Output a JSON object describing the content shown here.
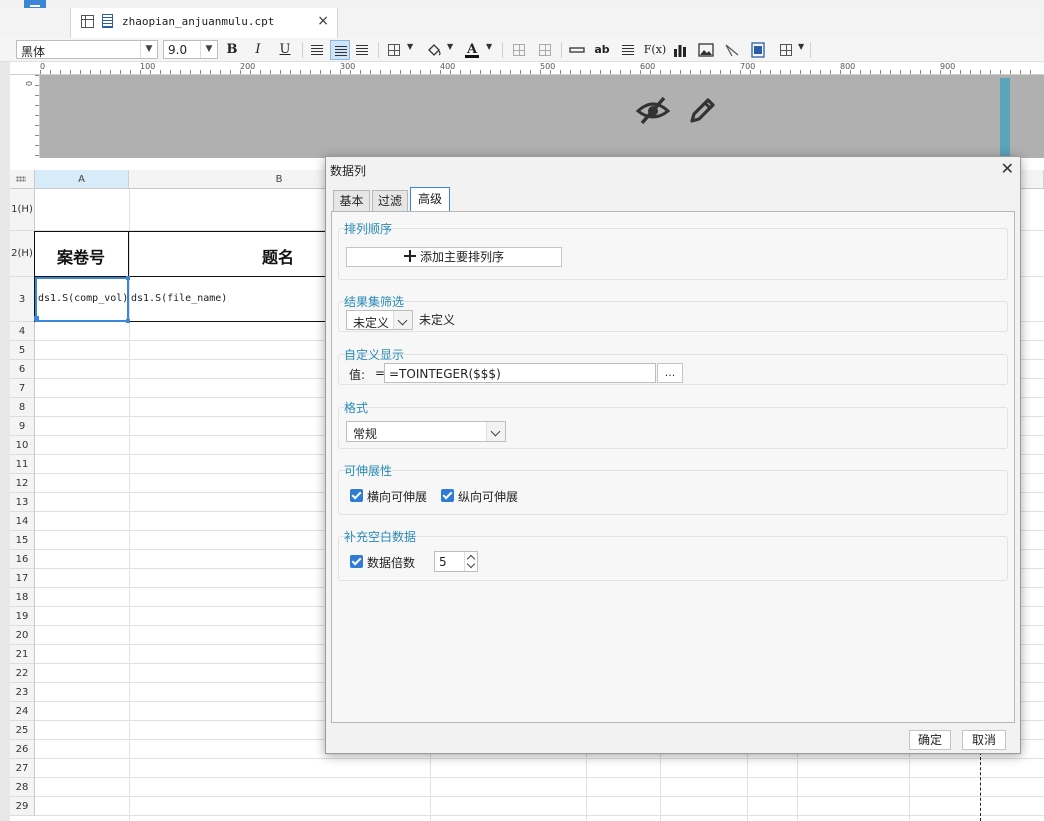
{
  "file_tab": {
    "filename": "zhaopian_anjuanmulu.cpt",
    "close": "×"
  },
  "toolbar": {
    "font_family": "黑体",
    "font_size": "9.0",
    "bold": "B",
    "italic": "I",
    "underline": "U",
    "text_label": "ab",
    "formula_label": "F(x)"
  },
  "ruler": {
    "ticks": [
      "0",
      "100",
      "200",
      "300",
      "400",
      "500",
      "600",
      "700",
      "800",
      "900"
    ],
    "v_zero": "0"
  },
  "sheet": {
    "columns": [
      "A",
      "B"
    ],
    "rows": [
      "1(H)",
      "2(H)",
      "3",
      "4",
      "5",
      "6",
      "7",
      "8",
      "9",
      "10",
      "11",
      "12",
      "13",
      "14",
      "15",
      "16",
      "17",
      "18",
      "19",
      "20",
      "21",
      "22",
      "23",
      "24",
      "25",
      "26",
      "27",
      "28",
      "29"
    ],
    "header_a": "案卷号",
    "header_b": "题名",
    "cell_a3": "ds1.S(comp_vol)",
    "cell_b3": "ds1.S(file_name)"
  },
  "dialog": {
    "title": "数据列",
    "close": "✕",
    "tabs": [
      "基本",
      "过滤",
      "高级"
    ],
    "active_tab": "高级",
    "sort_section": {
      "title": "排列顺序",
      "add_button": "添加主要排列序"
    },
    "filter_section": {
      "title": "结果集筛选",
      "selected": "未定义",
      "value_text": "未定义"
    },
    "display_section": {
      "title": "自定义显示",
      "label": "值:",
      "eq": "=",
      "value": "=TOINTEGER($$$)",
      "more": "..."
    },
    "format_section": {
      "title": "格式",
      "selected": "常规"
    },
    "expand_section": {
      "title": "可伸展性",
      "horizontal": "横向可伸展",
      "vertical": "纵向可伸展"
    },
    "fill_section": {
      "title": "补充空白数据",
      "multiple_label": "数据倍数",
      "multiple_value": "5"
    },
    "ok": "确定",
    "cancel": "取消"
  }
}
